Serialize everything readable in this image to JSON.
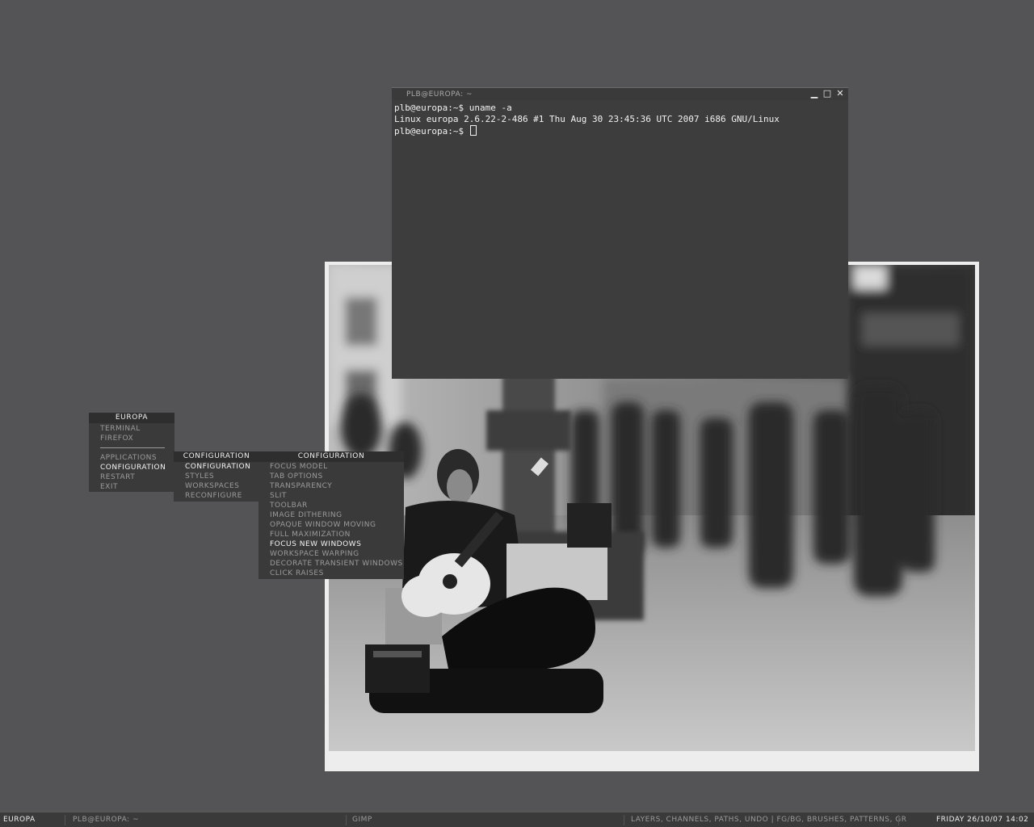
{
  "terminal": {
    "title": "PLB@EUROPA: ~",
    "buttons": {
      "minimize": "▁",
      "maximize": "□",
      "close": "✕"
    },
    "lines": [
      "plb@europa:~$ uname -a",
      "Linux europa 2.6.22-2-486 #1 Thu Aug 30 23:45:36 UTC 2007 i686 GNU/Linux",
      "plb@europa:~$ "
    ]
  },
  "root_menu": {
    "title": "EUROPA",
    "items_top": [
      "TERMINAL",
      "FIREFOX"
    ],
    "items_bottom": [
      "APPLICATIONS",
      "CONFIGURATION",
      "RESTART",
      "EXIT"
    ]
  },
  "config_menu": {
    "title": "CONFIGURATION",
    "items": [
      "CONFIGURATION",
      "STYLES",
      "WORKSPACES",
      "RECONFIGURE"
    ]
  },
  "config_submenu": {
    "title": "CONFIGURATION",
    "items": [
      "FOCUS MODEL",
      "TAB OPTIONS",
      "TRANSPARENCY",
      "SLIT",
      "TOOLBAR",
      "IMAGE DITHERING",
      "OPAQUE WINDOW MOVING",
      "FULL MAXIMIZATION",
      "FOCUS NEW WINDOWS",
      "WORKSPACE WARPING",
      "DECORATE TRANSIENT WINDOWS",
      "CLICK RAISES"
    ]
  },
  "taskbar": {
    "workspace": "EUROPA",
    "task_terminal": "PLB@EUROPA: ~",
    "task_gimp": "GIMP",
    "task_layers": "LAYERS, CHANNELS, PATHS, UNDO | FG/BG, BRUSHES, PATTERNS, GR",
    "clock": "FRIDAY 26/10/07 14:02"
  },
  "colors": {
    "desktop": "#545456",
    "menu_bg": "#3a3a3a",
    "text_dim": "#9b9b9b",
    "text_bright": "#f4f4f4"
  }
}
